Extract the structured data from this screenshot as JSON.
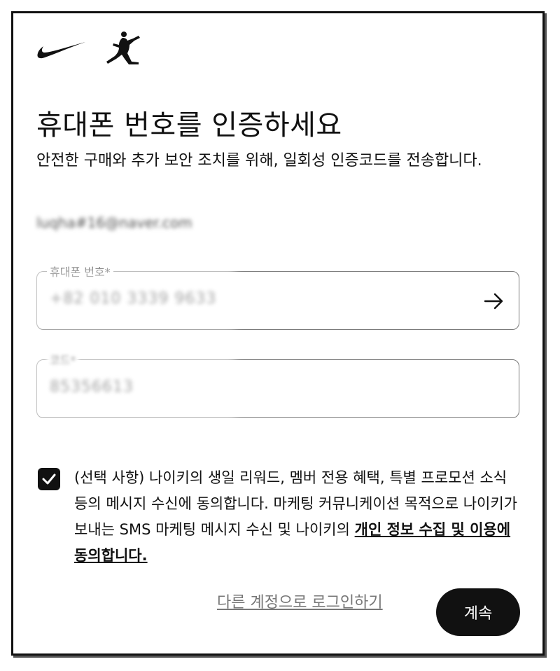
{
  "brand": {
    "logos": [
      "nike-swoosh-icon",
      "jordan-jumpman-icon"
    ]
  },
  "page": {
    "title": "휴대폰 번호를 인증하세요",
    "subtitle": "안전한 구매와 추가 보안 조치를 위해, 일회성 인증코드를 전송합니다.",
    "email": "luqha#16@naver.com"
  },
  "phone_field": {
    "label": "휴대폰 번호*",
    "value": "+82 010 3339 9633",
    "submit_icon": "arrow-right-icon"
  },
  "code_field": {
    "label": "코드*",
    "value": "85356613"
  },
  "consent": {
    "checked": true,
    "text": "(선택 사항) 나이키의 생일 리워드, 멤버 전용 혜택, 특별 프로모션 소식 등의 메시지 수신에 동의합니다. 마케팅 커뮤니케이션 목적으로 나이키가 보내는 SMS 마케팅 메시지 수신 및 나이키의 ",
    "link": "개인 정보 수집 및 이용에 동의합니다."
  },
  "actions": {
    "alt_login": "다른 계정으로 로그인하기",
    "continue": "계속"
  },
  "colors": {
    "accent": "#111111",
    "border": "#7a7a7a",
    "muted_link": "#777777"
  }
}
